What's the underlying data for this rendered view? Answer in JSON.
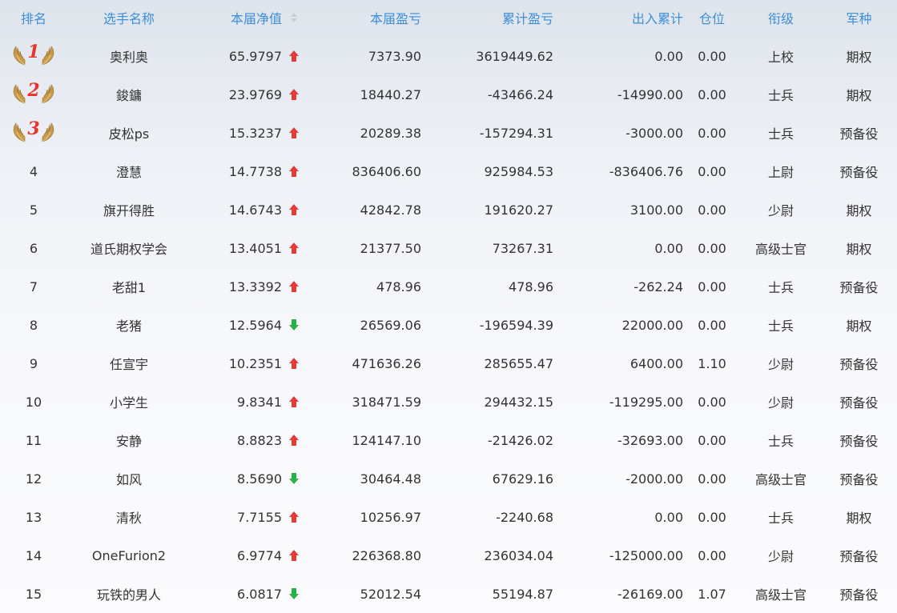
{
  "colors": {
    "header_text": "#3d8fd8",
    "up_arrow": "#e23b3b",
    "down_arrow": "#23b34a",
    "medal_number": "#e8342e"
  },
  "header": {
    "rank": "排名",
    "name": "选手名称",
    "nav": "本届净值",
    "pnl": "本届盈亏",
    "cum_pnl": "累计盈亏",
    "cum_flow": "出入累计",
    "position": "仓位",
    "title_rank": "衔级",
    "branch": "军种"
  },
  "rows": [
    {
      "rank": "1",
      "medal": true,
      "name": "奥利奥",
      "nav": "65.9797",
      "trend": "up",
      "pnl": "7373.90",
      "cum_pnl": "3619449.62",
      "cum_flow": "0.00",
      "position": "0.00",
      "title_rank": "上校",
      "branch": "期权"
    },
    {
      "rank": "2",
      "medal": true,
      "name": "鋑鏞",
      "nav": "23.9769",
      "trend": "up",
      "pnl": "18440.27",
      "cum_pnl": "-43466.24",
      "cum_flow": "-14990.00",
      "position": "0.00",
      "title_rank": "士兵",
      "branch": "期权"
    },
    {
      "rank": "3",
      "medal": true,
      "name": "皮松ps",
      "nav": "15.3237",
      "trend": "up",
      "pnl": "20289.38",
      "cum_pnl": "-157294.31",
      "cum_flow": "-3000.00",
      "position": "0.00",
      "title_rank": "士兵",
      "branch": "预备役"
    },
    {
      "rank": "4",
      "medal": false,
      "name": "澄慧",
      "nav": "14.7738",
      "trend": "up",
      "pnl": "836406.60",
      "cum_pnl": "925984.53",
      "cum_flow": "-836406.76",
      "position": "0.00",
      "title_rank": "上尉",
      "branch": "预备役"
    },
    {
      "rank": "5",
      "medal": false,
      "name": "旗开得胜",
      "nav": "14.6743",
      "trend": "up",
      "pnl": "42842.78",
      "cum_pnl": "191620.27",
      "cum_flow": "3100.00",
      "position": "0.00",
      "title_rank": "少尉",
      "branch": "期权"
    },
    {
      "rank": "6",
      "medal": false,
      "name": "道氏期权学会",
      "nav": "13.4051",
      "trend": "up",
      "pnl": "21377.50",
      "cum_pnl": "73267.31",
      "cum_flow": "0.00",
      "position": "0.00",
      "title_rank": "高级士官",
      "branch": "期权"
    },
    {
      "rank": "7",
      "medal": false,
      "name": "老甜1",
      "nav": "13.3392",
      "trend": "up",
      "pnl": "478.96",
      "cum_pnl": "478.96",
      "cum_flow": "-262.24",
      "position": "0.00",
      "title_rank": "士兵",
      "branch": "预备役"
    },
    {
      "rank": "8",
      "medal": false,
      "name": "老猪",
      "nav": "12.5964",
      "trend": "down",
      "pnl": "26569.06",
      "cum_pnl": "-196594.39",
      "cum_flow": "22000.00",
      "position": "0.00",
      "title_rank": "士兵",
      "branch": "期权"
    },
    {
      "rank": "9",
      "medal": false,
      "name": "任宣宇",
      "nav": "10.2351",
      "trend": "up",
      "pnl": "471636.26",
      "cum_pnl": "285655.47",
      "cum_flow": "6400.00",
      "position": "1.10",
      "title_rank": "少尉",
      "branch": "预备役"
    },
    {
      "rank": "10",
      "medal": false,
      "name": "小学生",
      "nav": "9.8341",
      "trend": "up",
      "pnl": "318471.59",
      "cum_pnl": "294432.15",
      "cum_flow": "-119295.00",
      "position": "0.00",
      "title_rank": "少尉",
      "branch": "预备役"
    },
    {
      "rank": "11",
      "medal": false,
      "name": "安静",
      "nav": "8.8823",
      "trend": "up",
      "pnl": "124147.10",
      "cum_pnl": "-21426.02",
      "cum_flow": "-32693.00",
      "position": "0.00",
      "title_rank": "士兵",
      "branch": "预备役"
    },
    {
      "rank": "12",
      "medal": false,
      "name": "如风",
      "nav": "8.5690",
      "trend": "down",
      "pnl": "30464.48",
      "cum_pnl": "67629.16",
      "cum_flow": "-2000.00",
      "position": "0.00",
      "title_rank": "高级士官",
      "branch": "预备役"
    },
    {
      "rank": "13",
      "medal": false,
      "name": "清秋",
      "nav": "7.7155",
      "trend": "up",
      "pnl": "10256.97",
      "cum_pnl": "-2240.68",
      "cum_flow": "0.00",
      "position": "0.00",
      "title_rank": "士兵",
      "branch": "期权"
    },
    {
      "rank": "14",
      "medal": false,
      "name": "OneFurion2",
      "nav": "6.9774",
      "trend": "up",
      "pnl": "226368.80",
      "cum_pnl": "236034.04",
      "cum_flow": "-125000.00",
      "position": "0.00",
      "title_rank": "少尉",
      "branch": "预备役"
    },
    {
      "rank": "15",
      "medal": false,
      "name": "玩铁的男人",
      "nav": "6.0817",
      "trend": "down",
      "pnl": "52012.54",
      "cum_pnl": "55194.87",
      "cum_flow": "-26169.00",
      "position": "1.07",
      "title_rank": "高级士官",
      "branch": "预备役"
    }
  ]
}
